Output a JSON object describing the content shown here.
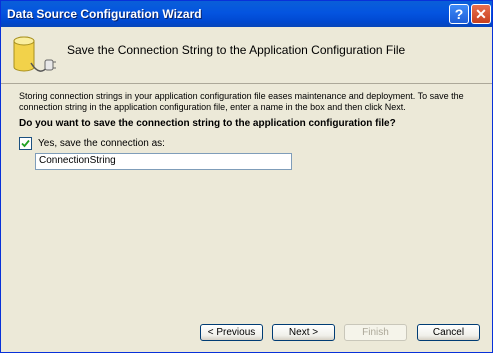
{
  "window": {
    "title": "Data Source Configuration Wizard",
    "help_glyph": "?",
    "close_glyph": "✕"
  },
  "header": {
    "heading": "Save the Connection String to the Application Configuration File",
    "icon": "database-plug-icon"
  },
  "body": {
    "description": "Storing connection strings in your application configuration file eases maintenance and deployment. To save the connection string in the application configuration file, enter a name in the box and then click Next.",
    "question": "Do you want to save the connection string to the application configuration file?",
    "save_checkbox": {
      "label": "Yes, save the connection as:",
      "checked": true
    },
    "connection_name": "ConnectionString"
  },
  "buttons": {
    "previous": "< Previous",
    "next": "Next >",
    "finish": "Finish",
    "cancel": "Cancel"
  },
  "colors": {
    "titlebar": "#0454E0",
    "dialog_bg": "#ECE9D8",
    "check_mark": "#21A121"
  }
}
